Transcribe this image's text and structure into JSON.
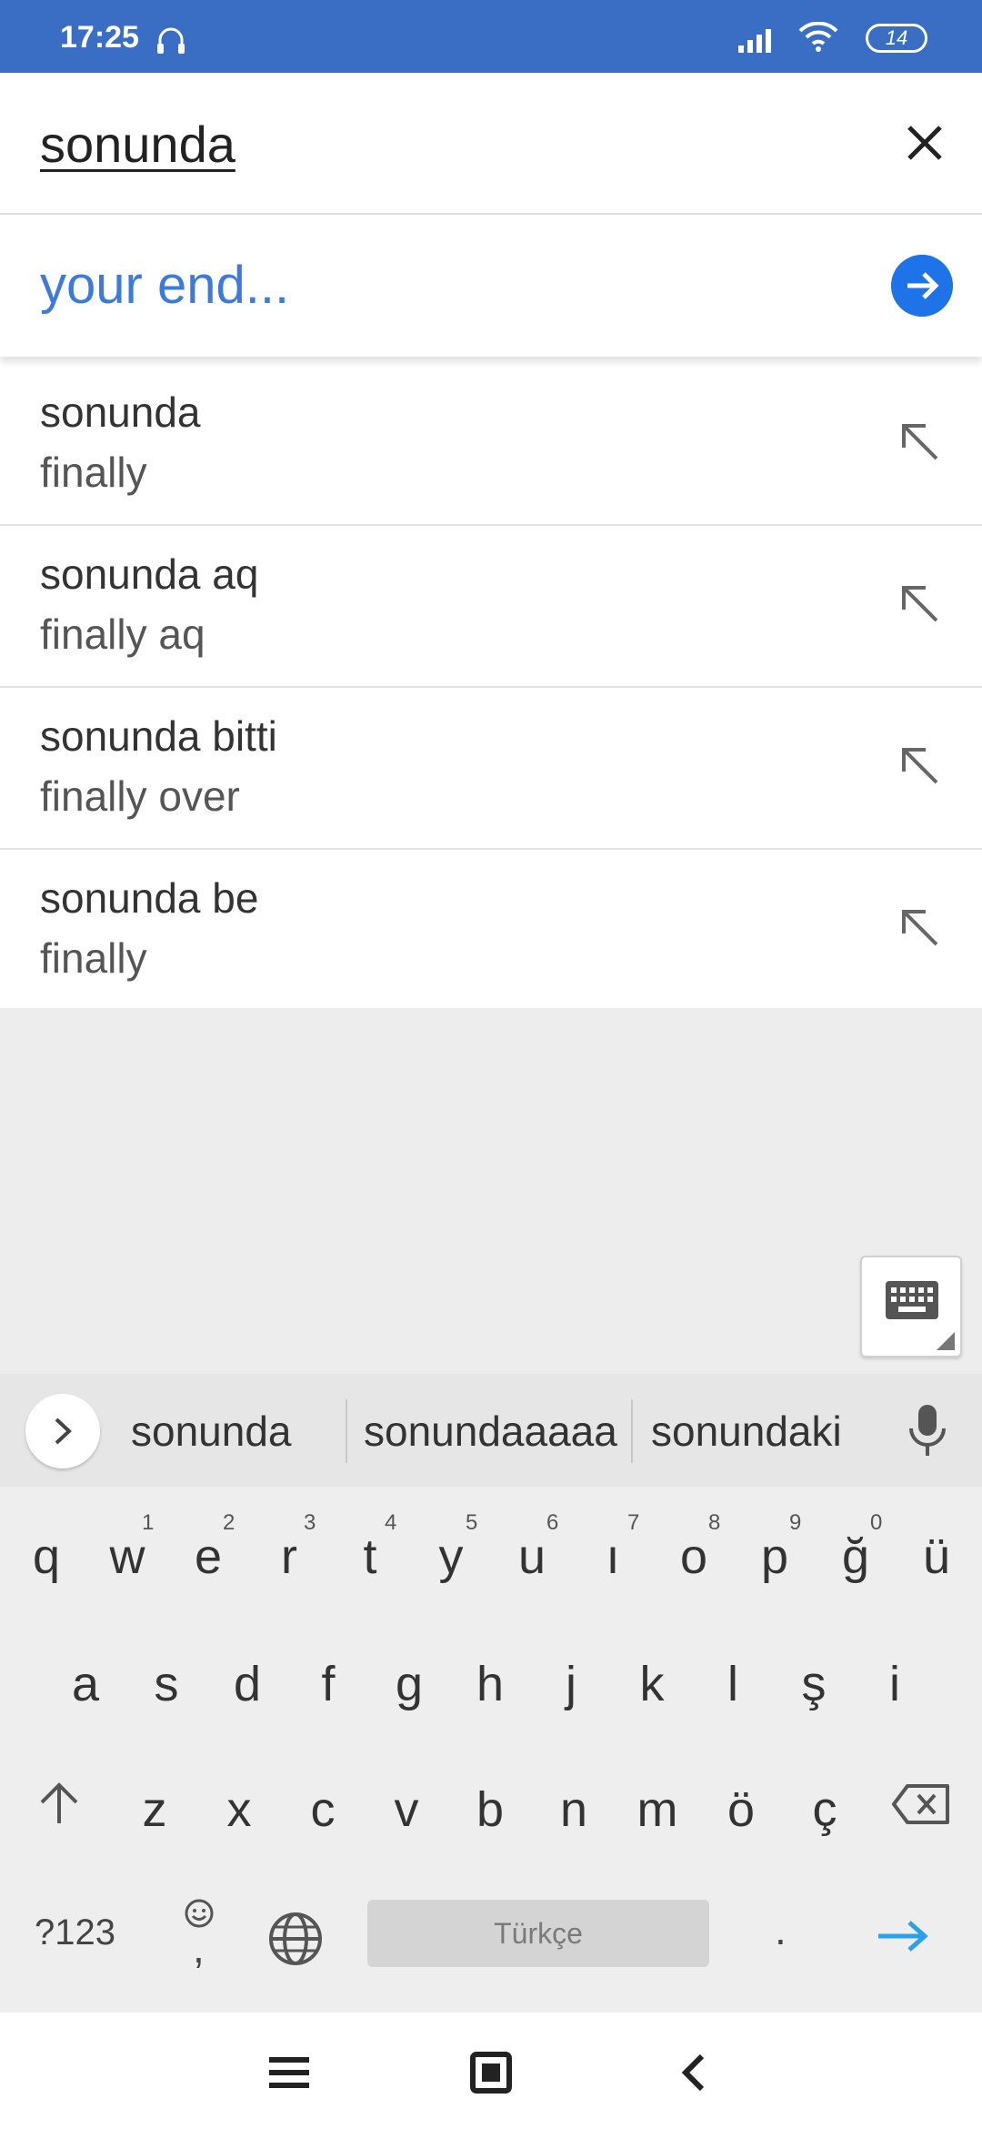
{
  "status_bar": {
    "time": "17:25",
    "battery": "14",
    "color": "#3a6dc4"
  },
  "search": {
    "query": "sonunda",
    "clear_icon": "close-icon"
  },
  "translation": {
    "text": "your end...",
    "go_icon": "arrow-right-circle-icon",
    "accent": "#1f73e8"
  },
  "suggestions": [
    {
      "source": "sonunda",
      "target": "finally"
    },
    {
      "source": "sonunda aq",
      "target": "finally aq"
    },
    {
      "source": "sonunda bitti",
      "target": "finally over"
    },
    {
      "source": "sonunda be",
      "target": "finally"
    }
  ],
  "keyboard": {
    "suggestion_strip": [
      "sonunda",
      "sonundaaaaa",
      "sonundaki"
    ],
    "row1": [
      "q",
      "w",
      "e",
      "r",
      "t",
      "y",
      "u",
      "ı",
      "o",
      "p",
      "ğ",
      "ü"
    ],
    "row1_numbers": [
      "1",
      "2",
      "3",
      "4",
      "5",
      "6",
      "7",
      "8",
      "9",
      "0"
    ],
    "row2": [
      "a",
      "s",
      "d",
      "f",
      "g",
      "h",
      "j",
      "k",
      "l",
      "ş",
      "i"
    ],
    "row3": [
      "z",
      "x",
      "c",
      "v",
      "b",
      "n",
      "m",
      "ö",
      "ç"
    ],
    "symbols_key": "?123",
    "comma_key": ",",
    "period_key": ".",
    "space_label": "Türkçe",
    "enter_color": "#2aa1e8"
  }
}
